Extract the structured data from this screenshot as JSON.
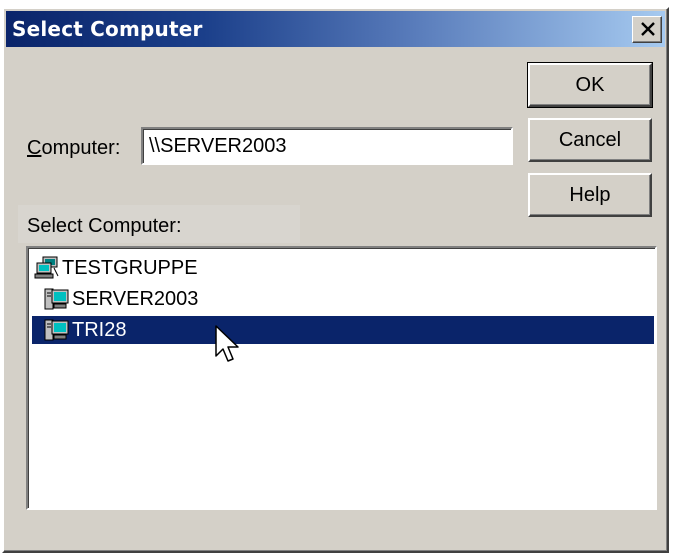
{
  "window": {
    "title": "Select Computer",
    "close_icon": "close-icon"
  },
  "computer_field": {
    "label": "Computer:",
    "value": "\\\\SERVER2003"
  },
  "buttons": {
    "ok": "OK",
    "cancel": "Cancel",
    "help": "Help"
  },
  "list": {
    "label": "Select Computer:",
    "items": [
      {
        "label": "TESTGRUPPE",
        "icon": "workgroup-icon",
        "selected": false
      },
      {
        "label": "SERVER2003",
        "icon": "computer-icon",
        "selected": false
      },
      {
        "label": "TRI28",
        "icon": "computer-icon",
        "selected": true
      }
    ]
  },
  "colors": {
    "selection": "#0a246a",
    "dialog_face": "#d4d0c8",
    "title_start": "#0a246a",
    "title_end": "#a6caf0"
  }
}
